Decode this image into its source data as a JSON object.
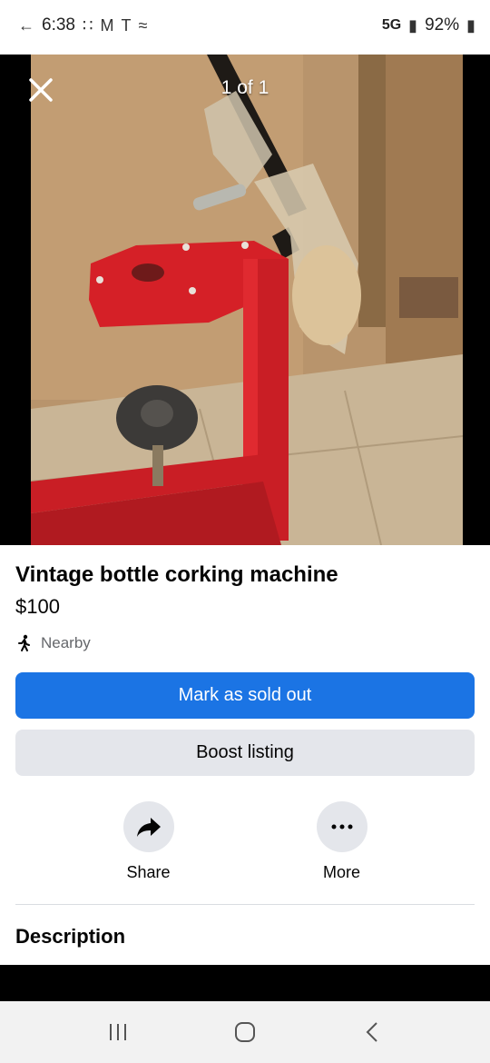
{
  "status_bar": {
    "time": "6:38",
    "network": "5G",
    "battery": "92%"
  },
  "photo": {
    "counter": "1 of 1",
    "description_icon": "photo-bottle-corker"
  },
  "listing": {
    "title": "Vintage bottle corking machine",
    "price": "$100",
    "location": "Nearby"
  },
  "buttons": {
    "primary": "Mark as sold out",
    "secondary": "Boost listing"
  },
  "actions": {
    "share": "Share",
    "more": "More"
  },
  "sections": {
    "description_title": "Description"
  },
  "colors": {
    "primary_blue": "#1b74e4",
    "secondary_gray": "#e4e6eb",
    "text": "#050505",
    "muted": "#65676b"
  }
}
